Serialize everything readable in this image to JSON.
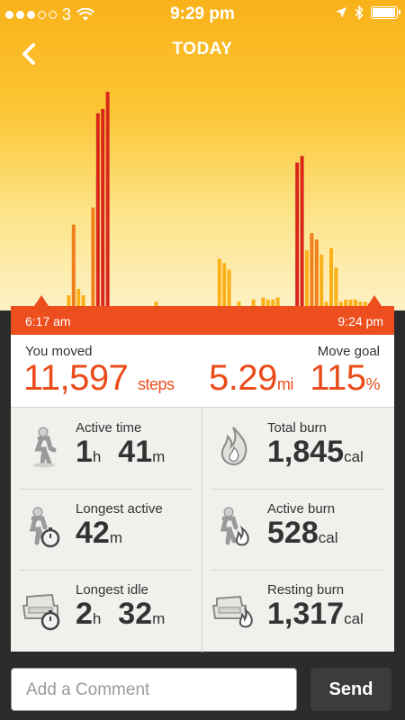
{
  "status_bar": {
    "carrier": "3",
    "time": "9:29 pm",
    "signal_bars_filled": 3,
    "signal_bars_total": 5,
    "battery_level": 0.9
  },
  "header": {
    "title": "TODAY",
    "back_icon": "chevron-left-icon"
  },
  "chart_data": {
    "type": "bar",
    "range_start": "6:17 am",
    "range_end": "9:24 pm",
    "series_colors": {
      "high": "#d9261b",
      "mid": "#f07f1d",
      "low": "#fbb018"
    },
    "values": [
      0,
      0,
      0,
      0,
      0,
      0,
      0.05,
      0.38,
      0.08,
      0.05,
      0,
      0.46,
      0.9,
      0.92,
      1.0,
      0,
      0,
      0,
      0,
      0,
      0,
      0,
      0,
      0,
      0.02,
      0,
      0,
      0,
      0,
      0,
      0,
      0,
      0,
      0,
      0,
      0,
      0,
      0.22,
      0.2,
      0.17,
      0,
      0.02,
      0,
      0,
      0.03,
      0,
      0.04,
      0.03,
      0.03,
      0.04,
      0,
      0,
      0,
      0.67,
      0.7,
      0.26,
      0.34,
      0.31,
      0.24,
      0.02,
      0.27,
      0.18,
      0.02,
      0.03,
      0.03,
      0.03,
      0.02,
      0.02,
      0,
      0
    ]
  },
  "timeline": {
    "start": "6:17 am",
    "end": "9:24 pm"
  },
  "summary": {
    "moved_label": "You moved",
    "steps_value": "11,597",
    "steps_unit": "steps",
    "distance_value": "5.29",
    "distance_unit": "mi",
    "goal_label": "Move goal",
    "goal_value": "115",
    "goal_unit": "%"
  },
  "stats": [
    {
      "label": "Active time",
      "v1": "1",
      "u1": "h",
      "v2": "41",
      "u2": "m",
      "icon": "walking-person-icon"
    },
    {
      "label": "Total burn",
      "v1": "1,845",
      "u1": "cal",
      "v2": "",
      "u2": "",
      "icon": "flame-icon"
    },
    {
      "label": "Longest active",
      "v1": "42",
      "u1": "m",
      "v2": "",
      "u2": "",
      "icon": "person-stopwatch-icon"
    },
    {
      "label": "Active burn",
      "v1": "528",
      "u1": "cal",
      "v2": "",
      "u2": "",
      "icon": "person-flame-icon"
    },
    {
      "label": "Longest idle",
      "v1": "2",
      "u1": "h",
      "v2": "32",
      "u2": "m",
      "icon": "armchair-stopwatch-icon"
    },
    {
      "label": "Resting burn",
      "v1": "1,317",
      "u1": "cal",
      "v2": "",
      "u2": "",
      "icon": "armchair-flame-icon"
    }
  ],
  "comment": {
    "placeholder": "Add a Comment",
    "send_label": "Send"
  }
}
